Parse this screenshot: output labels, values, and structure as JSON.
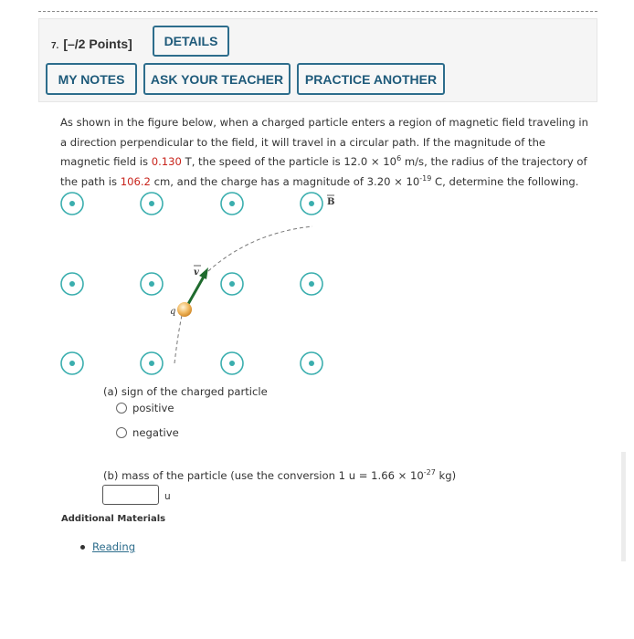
{
  "question": {
    "number": "7.",
    "points": "[–/2 Points]",
    "buttons": {
      "details": "DETAILS",
      "my_notes": "MY NOTES",
      "ask_teacher": "ASK YOUR TEACHER",
      "practice_another": "PRACTICE ANOTHER"
    }
  },
  "prompt": {
    "t1": "As shown in the figure below, when a charged particle enters a region of magnetic field traveling in a direction perpendicular to the field, it will travel in a circular path. If the magnitude of the magnetic field is ",
    "field_value": "0.130",
    "t2": " T, the speed of the particle is 12.0 × 10",
    "speed_exp": "6",
    "t3": " m/s, the radius of the trajectory of the path is ",
    "radius_value": "106.2",
    "t4": " cm, and the charge has a magnitude of 3.20 × 10",
    "charge_exp": "-19",
    "t5": " C, determine the following."
  },
  "figure": {
    "field_label": "B",
    "velocity_label": "v",
    "charge_label": "q",
    "field_color": "#3aaeae",
    "arrow_color": "#1f6b2e",
    "particle_color": "#f0b860"
  },
  "part_a": {
    "label": "(a) sign of the charged particle",
    "options": [
      "positive",
      "negative"
    ]
  },
  "part_b": {
    "label_pre": "(b) mass of the particle (use the conversion 1 u = 1.66 × 10",
    "label_exp": "-27",
    "label_post": " kg)",
    "input_value": "",
    "unit": "u"
  },
  "additional": {
    "heading": "Additional Materials",
    "links": [
      "Reading"
    ]
  }
}
